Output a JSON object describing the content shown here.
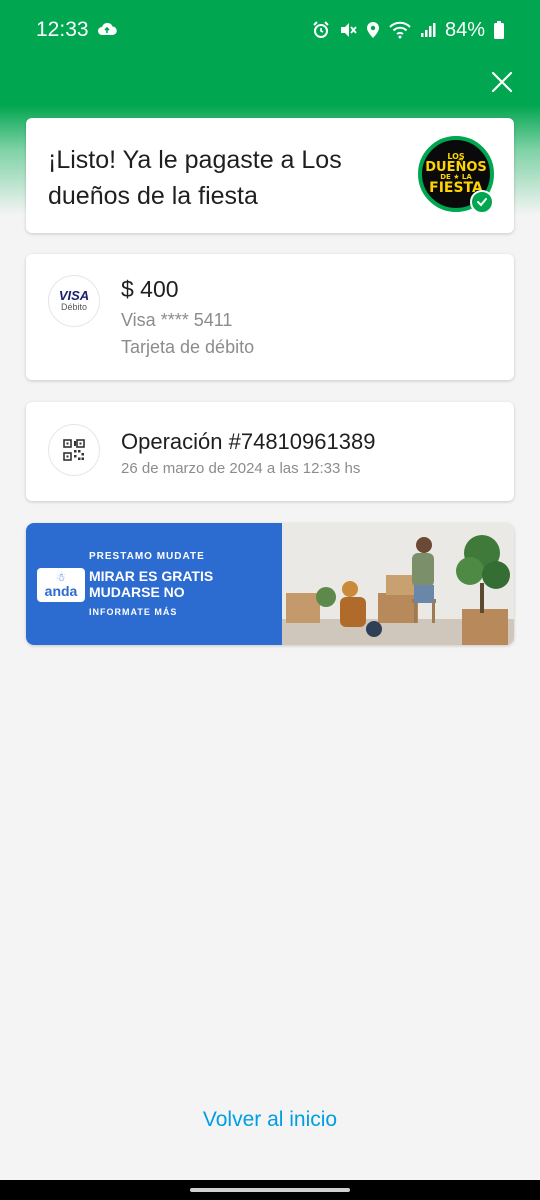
{
  "status_bar": {
    "time": "12:33",
    "battery": "84%",
    "icons": [
      "cloud-sync-icon",
      "alarm-icon",
      "mute-icon",
      "location-icon",
      "wifi-icon",
      "signal-icon",
      "battery-icon"
    ]
  },
  "header": {
    "close_icon": "close-icon",
    "accent_color": "#00a650"
  },
  "success": {
    "title": "¡Listo! Ya le pagaste a Los dueños de la fiesta",
    "logo_lines": [
      "LOS",
      "DUEÑOS",
      "DE ★ LA",
      "FIESTA"
    ]
  },
  "payment": {
    "brand": "VISA",
    "brand_sub": "Débito",
    "amount": "$ 400",
    "card_masked": "Visa **** 5411",
    "card_type": "Tarjeta de débito"
  },
  "operation": {
    "icon": "qr-code-icon",
    "number": "Operación #74810961389",
    "date": "26 de marzo de 2024 a las 12:33 hs"
  },
  "banner": {
    "logo": "anda",
    "kicker": "PRESTAMO MUDATE",
    "headline": "MIRAR ES GRATIS MUDARSE NO",
    "cta": "INFORMATE MÁS",
    "color": "#2c6bd0"
  },
  "footer": {
    "back_link": "Volver al inicio",
    "link_color": "#009ee3"
  }
}
